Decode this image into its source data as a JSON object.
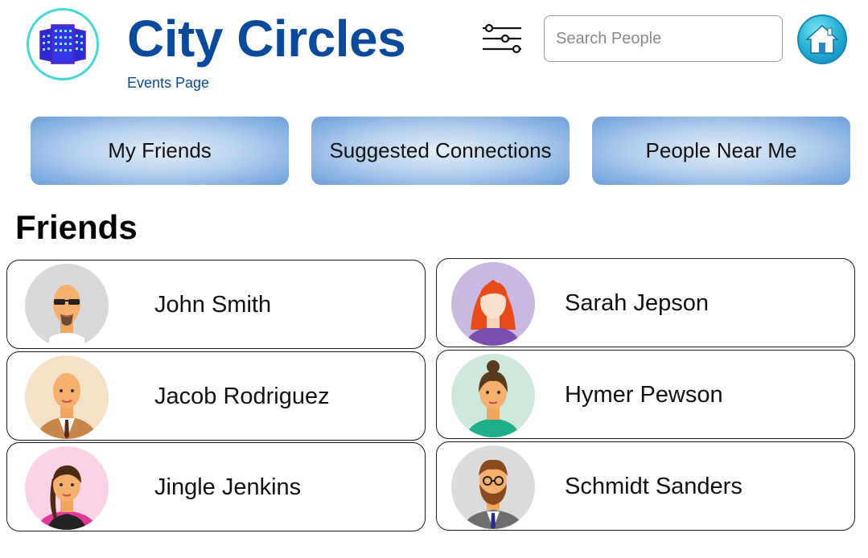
{
  "header": {
    "logo_icon": "city-buildings-logo",
    "title": "City Circles",
    "subtitle": "Events Page",
    "filter_icon": "sliders-icon",
    "search": {
      "placeholder": "Search People",
      "value": ""
    },
    "home_icon": "home-icon"
  },
  "nav": {
    "buttons": [
      {
        "label": "My Friends"
      },
      {
        "label": "Suggested Connections"
      },
      {
        "label": "People Near Me"
      }
    ]
  },
  "friends": {
    "heading": "Friends",
    "people": [
      {
        "name": "John Smith",
        "avatar": "bald-man-sunglasses-avatar",
        "avatar_bg": "#d9d9d9"
      },
      {
        "name": "Sarah Jepson",
        "avatar": "red-haired-woman-avatar",
        "avatar_bg": "#c9b9e0"
      },
      {
        "name": "Jacob Rodriguez",
        "avatar": "bald-man-suit-avatar",
        "avatar_bg": "#f6e0c8"
      },
      {
        "name": "Hymer Pewson",
        "avatar": "woman-bun-avatar",
        "avatar_bg": "#cfe8dc"
      },
      {
        "name": "Jingle Jenkins",
        "avatar": "woman-ponytail-avatar",
        "avatar_bg": "#fbd3e6"
      },
      {
        "name": "Schmidt Sanders",
        "avatar": "bearded-man-glasses-avatar",
        "avatar_bg": "#dcdcdc"
      }
    ]
  },
  "colors": {
    "brand": "#0a4a9c",
    "logo_ring": "#46d6dc",
    "nav_gradient_edge": "#6c9fda"
  }
}
